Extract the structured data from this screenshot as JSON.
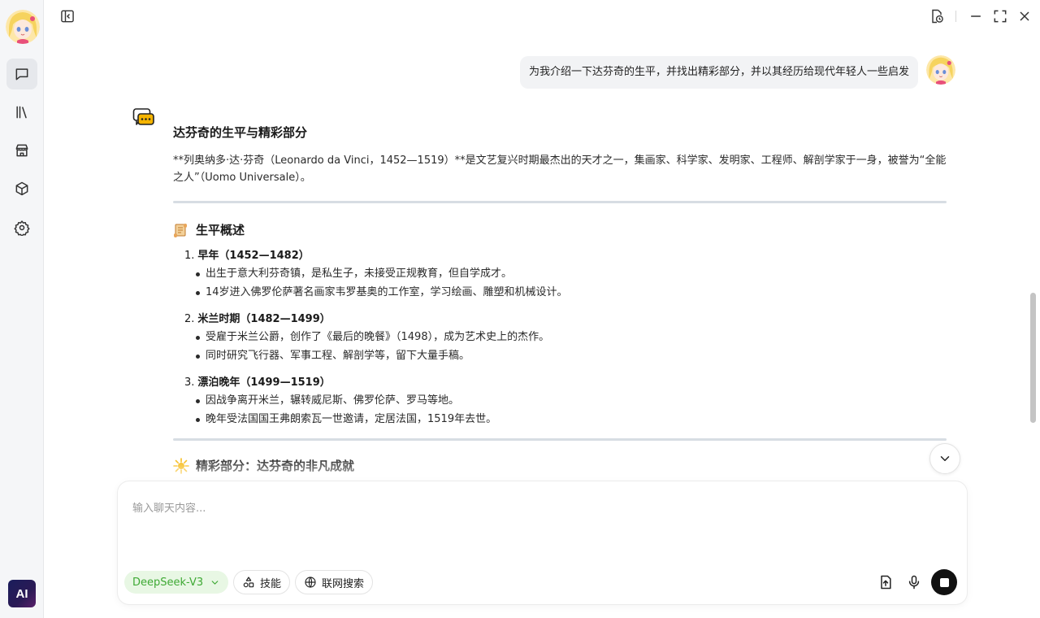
{
  "sidebar": {
    "items": [
      {
        "name": "chat-icon",
        "active": true
      },
      {
        "name": "library-icon",
        "active": false
      },
      {
        "name": "store-icon",
        "active": false
      },
      {
        "name": "cube-icon",
        "active": false
      },
      {
        "name": "settings-icon",
        "active": false
      }
    ],
    "app_logo_text": "AI"
  },
  "topbar": {
    "icons": [
      "sidebar-toggle-icon",
      "history-icon",
      "minimize-icon",
      "fullscreen-icon",
      "close-icon"
    ]
  },
  "messages": {
    "user": {
      "text": "为我介绍一下达芬奇的生平，并找出精彩部分，并以其经历给现代年轻人一些启发"
    },
    "assistant": {
      "heading": "达芬奇的生平与精彩部分",
      "intro": "**列奥纳多·达·芬奇（Leonardo da Vinci，1452—1519）**是文艺复兴时期最杰出的天才之一，集画家、科学家、发明家、工程师、解剖学家于一身，被誉为“全能之人”（Uomo Universale）。",
      "section1": {
        "title": "生平概述",
        "items": [
          {
            "num": "1.",
            "title": "早年（1452—1482）",
            "bullets": [
              "出生于意大利芬奇镇，是私生子，未接受正规教育，但自学成才。",
              "14岁进入佛罗伦萨著名画家韦罗基奥的工作室，学习绘画、雕塑和机械设计。"
            ]
          },
          {
            "num": "2.",
            "title": "米兰时期（1482—1499）",
            "bullets": [
              "受雇于米兰公爵，创作了《最后的晚餐》（1498），成为艺术史上的杰作。",
              "同时研究飞行器、军事工程、解剖学等，留下大量手稿。"
            ]
          },
          {
            "num": "3.",
            "title": "漂泊晚年（1499—1519）",
            "bullets": [
              "因战争离开米兰，辗转威尼斯、佛罗伦萨、罗马等地。",
              "晚年受法国国王弗朗索瓦一世邀请，定居法国，1519年去世。"
            ]
          }
        ]
      },
      "section2": {
        "title": "精彩部分：达芬奇的非凡成就"
      }
    }
  },
  "composer": {
    "placeholder": "输入聊天内容...",
    "model": "DeepSeek-V3",
    "skills_label": "技能",
    "web_search_label": "联网搜索"
  },
  "colors": {
    "model_pill_bg": "#e8f7e4",
    "model_pill_text": "#3ea934",
    "accent_dark": "#111111"
  }
}
